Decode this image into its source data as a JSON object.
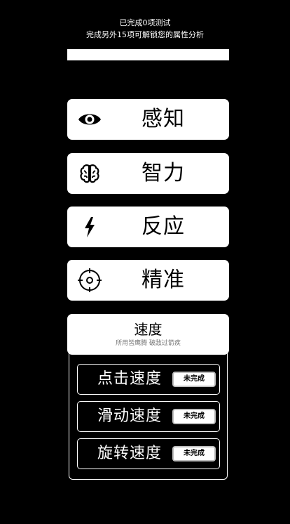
{
  "status": {
    "line1": "已完成0项测试",
    "line2": "完成另外15项可解锁您的属性分析",
    "progress": 0
  },
  "categories": [
    {
      "label": "感知",
      "icon": "eye-icon"
    },
    {
      "label": "智力",
      "icon": "brain-icon"
    },
    {
      "label": "反应",
      "icon": "lightning-icon"
    },
    {
      "label": "精准",
      "icon": "target-icon"
    }
  ],
  "speed": {
    "title": "速度",
    "subtitle": "所用皆鹰腾 破敌过箭疾",
    "items": [
      {
        "label": "点击速度",
        "button": "未完成"
      },
      {
        "label": "滑动速度",
        "button": "未完成"
      },
      {
        "label": "旋转速度",
        "button": "未完成"
      }
    ]
  },
  "colors": {
    "background": "#000000",
    "card": "#ffffff",
    "subtitle": "#777777",
    "button_border": "#bdbdbd"
  }
}
